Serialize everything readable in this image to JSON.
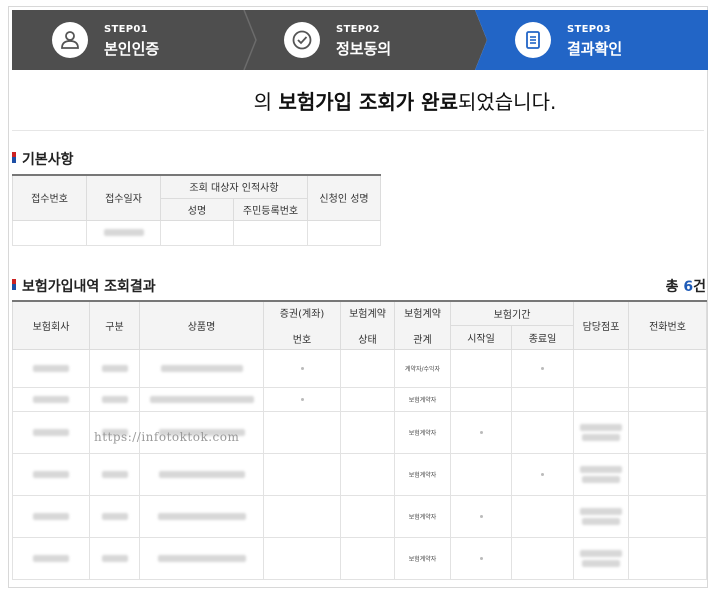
{
  "steps": [
    {
      "num": "STEP01",
      "label": "본인인증",
      "icon": "person-icon"
    },
    {
      "num": "STEP02",
      "label": "정보동의",
      "icon": "check-circle-icon"
    },
    {
      "num": "STEP03",
      "label": "결과확인",
      "icon": "document-icon"
    }
  ],
  "colors": {
    "step_inactive": "#4e4e4e",
    "step_active": "#2265c6",
    "accent_blue": "#1e5bb8"
  },
  "headline": {
    "prefix": "의 ",
    "emphasis": "보험가입 조회가 완료",
    "suffix": "되었습니다."
  },
  "basic": {
    "title": "기본사항",
    "headers": {
      "receipt_no": "접수번호",
      "receipt_date": "접수일자",
      "target_group": "조회 대상자 인적사항",
      "name": "성명",
      "rrn": "주민등록번호",
      "applicant": "신청인 성명"
    }
  },
  "results": {
    "title": "보험가입내역 조회결과",
    "count_prefix": "총 ",
    "count_value": "6",
    "count_suffix": "건",
    "headers": {
      "company": "보험회사",
      "category": "구분",
      "product": "상품명",
      "policy": "증권(계좌)",
      "policy2": "번호",
      "status": "보험계약",
      "status2": "상태",
      "relation": "보험계약",
      "relation2": "관계",
      "period": "보험기간",
      "start": "시작일",
      "end": "종료일",
      "branch": "담당점포",
      "phone": "전화번호"
    },
    "rows": [
      {
        "relation": "계약자/수익자"
      },
      {
        "relation": "보험계약자"
      },
      {
        "relation": "보험계약자"
      },
      {
        "relation": "보험계약자"
      },
      {
        "relation": "보험계약자"
      },
      {
        "relation": "보험계약자"
      }
    ]
  },
  "watermark": "https://infotoktok.com"
}
